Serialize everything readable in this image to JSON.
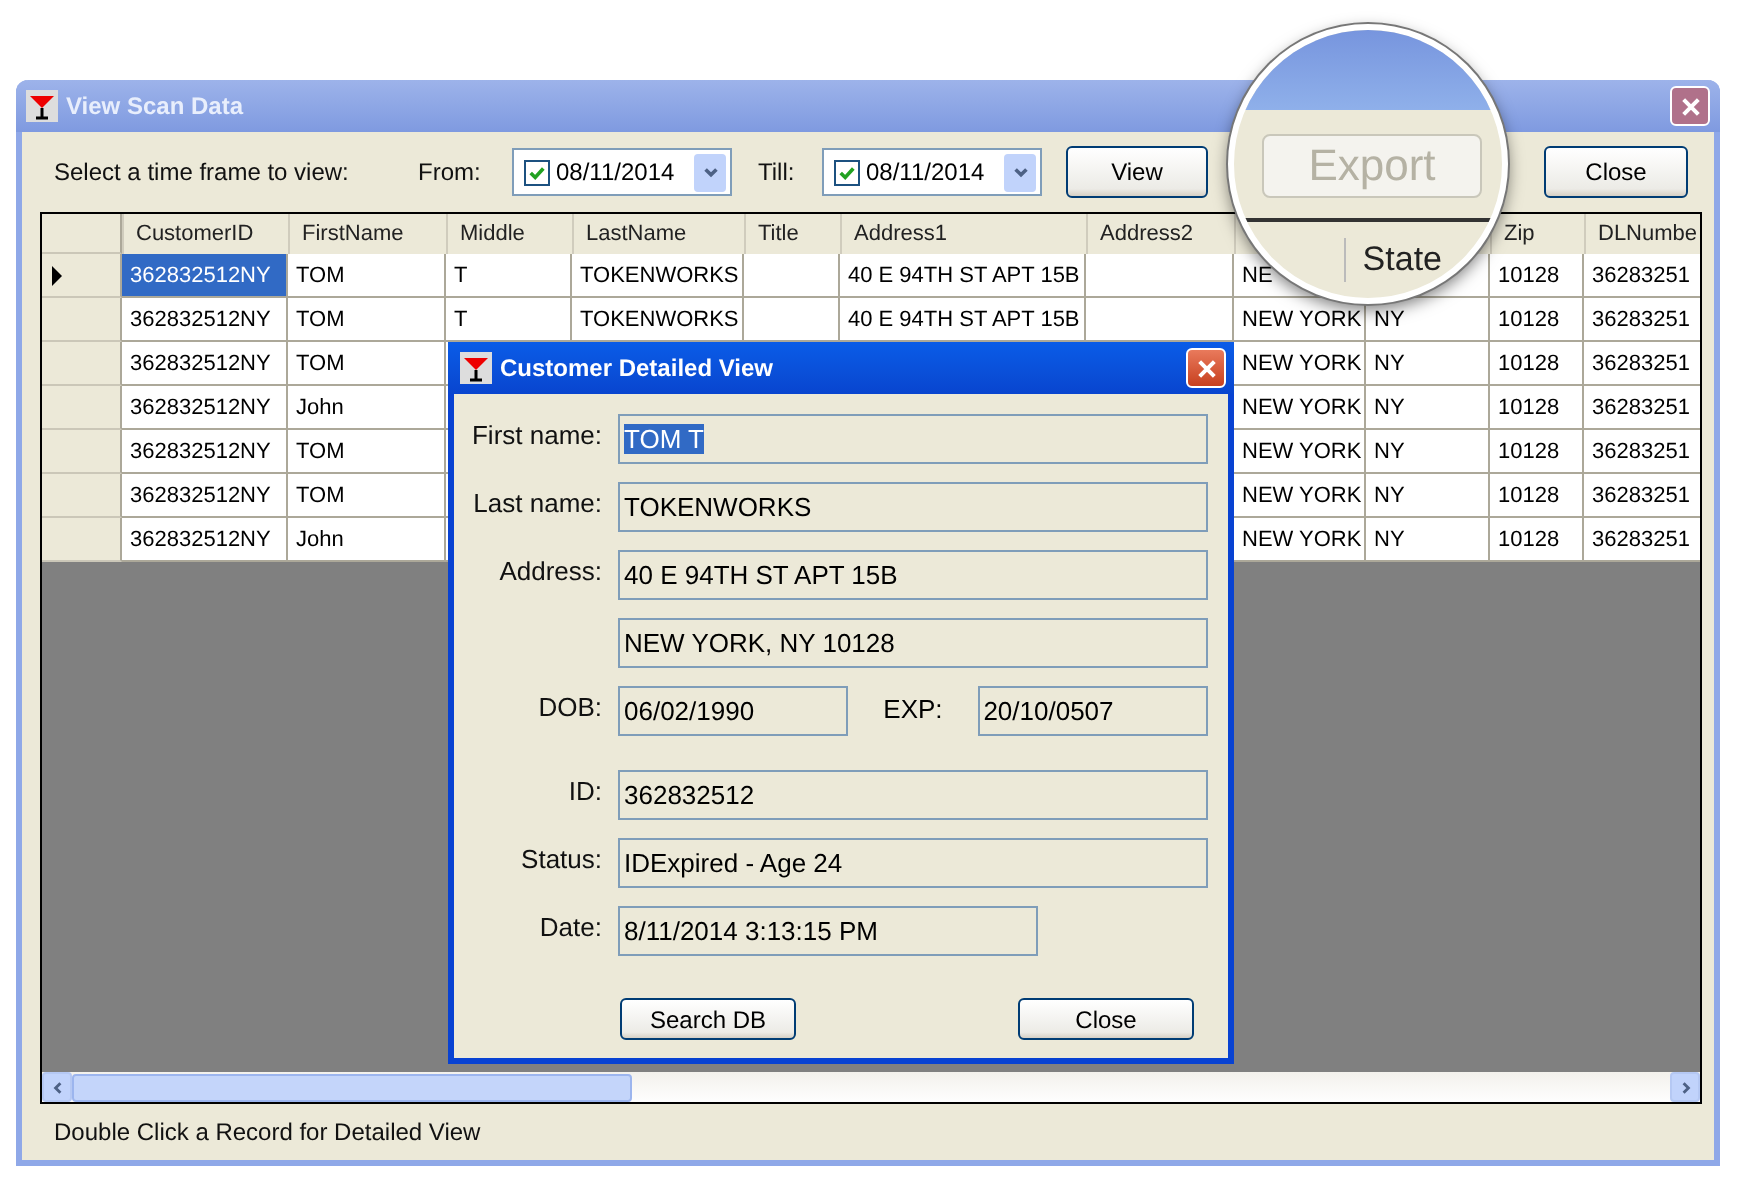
{
  "window": {
    "title": "View Scan Data"
  },
  "toolbar": {
    "prompt": "Select a time frame to view:",
    "from_label": "From:",
    "from": {
      "checked": true,
      "value": "08/11/2014"
    },
    "till_label": "Till:",
    "till": {
      "checked": true,
      "value": "08/11/2014"
    },
    "view_button": "View",
    "close_button": "Close"
  },
  "magnifier": {
    "export_button": {
      "label": "Export",
      "disabled": true
    },
    "column_label": "State"
  },
  "table": {
    "columns": [
      {
        "label": "CustomerID"
      },
      {
        "label": "FirstName"
      },
      {
        "label": "Middle"
      },
      {
        "label": "LastName"
      },
      {
        "label": "Title"
      },
      {
        "label": "Address1"
      },
      {
        "label": "Address2"
      },
      {},
      {},
      {
        "label": "Zip"
      },
      {
        "label": "DLNumbe"
      }
    ],
    "rows": [
      {
        "selected": true,
        "cells": [
          "362832512NY",
          "TOM",
          "T",
          "TOKENWORKS",
          null,
          "40 E 94TH ST APT 15B",
          null,
          "NE",
          null,
          "10128",
          "36283251"
        ]
      },
      {
        "selected": false,
        "cells": [
          "362832512NY",
          "TOM",
          "T",
          "TOKENWORKS",
          null,
          "40 E 94TH ST APT 15B",
          null,
          "NEW YORK",
          "NY",
          "10128",
          "36283251"
        ]
      },
      {
        "selected": false,
        "cells": [
          "362832512NY",
          "TOM",
          null,
          null,
          null,
          null,
          null,
          "NEW YORK",
          "NY",
          "10128",
          "36283251"
        ]
      },
      {
        "selected": false,
        "cells": [
          "362832512NY",
          "John",
          null,
          null,
          null,
          null,
          null,
          "NEW YORK",
          "NY",
          "10128",
          "36283251"
        ]
      },
      {
        "selected": false,
        "cells": [
          "362832512NY",
          "TOM",
          null,
          null,
          null,
          null,
          null,
          "NEW YORK",
          "NY",
          "10128",
          "36283251"
        ]
      },
      {
        "selected": false,
        "cells": [
          "362832512NY",
          "TOM",
          null,
          null,
          null,
          null,
          null,
          "NEW YORK",
          "NY",
          "10128",
          "36283251"
        ]
      },
      {
        "selected": false,
        "cells": [
          "362832512NY",
          "John",
          null,
          null,
          null,
          null,
          null,
          "NEW YORK",
          "NY",
          "10128",
          "36283251"
        ]
      }
    ]
  },
  "dialog": {
    "title": "Customer Detailed View",
    "fields": [
      {
        "kind": "wide",
        "label": "First name:",
        "value": "TOM T",
        "highlighted": true
      },
      {
        "kind": "wide",
        "label": "Last name:",
        "value": "TOKENWORKS",
        "highlighted": false
      },
      {
        "kind": "wide",
        "label": "Address:",
        "value": "40 E 94TH ST APT 15B",
        "highlighted": false
      },
      {
        "kind": "wide",
        "value": "NEW YORK, NY 10128",
        "highlighted": false
      },
      {
        "kind": "pair",
        "label": "DOB:",
        "value": "06/02/1990",
        "label2": "EXP:",
        "value2": "20/10/0507",
        "highlighted": false
      },
      {
        "kind": "wide",
        "label": "ID:",
        "value": "362832512",
        "highlighted": false
      },
      {
        "kind": "wide",
        "label": "Status:",
        "value": "IDExpired  - Age 24",
        "highlighted": false
      },
      {
        "kind": "short",
        "label": "Date:",
        "value": "8/11/2014 3:13:15 PM",
        "highlighted": false
      }
    ],
    "buttons": [
      "Search DB",
      "Close"
    ]
  },
  "status_bar": "Double Click a Record for Detailed View"
}
